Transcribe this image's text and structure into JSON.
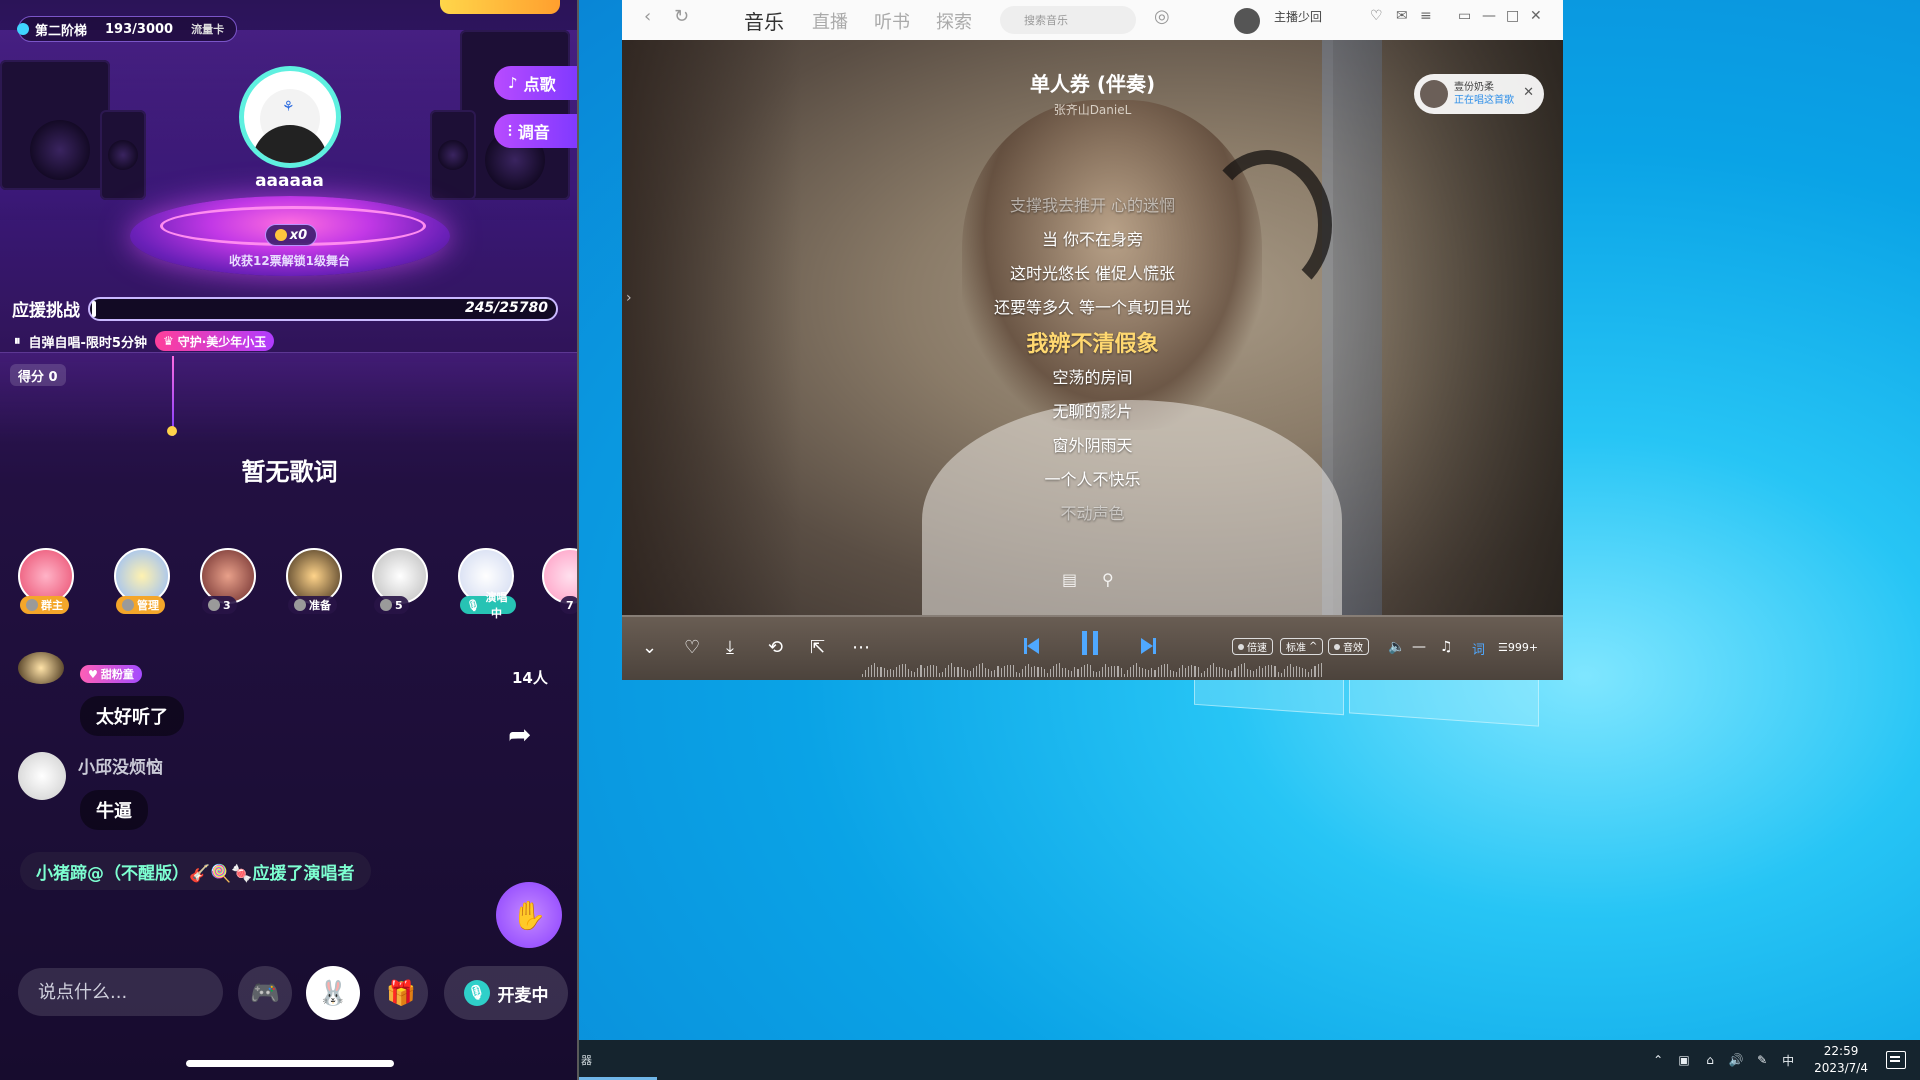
{
  "live_room": {
    "tier_label": "第二阶梯",
    "tier_progress": "193/3000",
    "traffic_card": "流量卡",
    "request_song": "点歌",
    "tune": "调音",
    "host_name": "aaaaaa",
    "podium_count": "x0",
    "podium_note": "收获12票解锁1级舞台",
    "support_label": "应援挑战",
    "support_value": "245/25780",
    "support_current": 245,
    "support_total": 25780,
    "mode_text": "自弹自唱-限时5分钟",
    "guard_chip": "守护·美少年小玉",
    "score": "得分 0",
    "no_lyrics": "暂无歌词",
    "seats": [
      {
        "tag": "群主"
      },
      {
        "tag": "管理"
      },
      {
        "tag": "3"
      },
      {
        "tag": "准备"
      },
      {
        "tag": "5"
      },
      {
        "tag": "演唱中"
      },
      {
        "tag": "7"
      }
    ],
    "people_count": "14人",
    "fan_badge": "甜粉童",
    "chat": [
      {
        "user": "",
        "text": "太好听了"
      },
      {
        "user": "小邱没烦恼",
        "text": "牛逼"
      }
    ],
    "system_msg": "小猪蹄@（不醒版）🎸🍭🍬应援了演唱者",
    "say_placeholder": "说点什么...",
    "mic_label": "开麦中"
  },
  "player": {
    "nav_tabs": [
      "音乐",
      "直播",
      "听书",
      "探索"
    ],
    "search_placeholder": "搜索音乐",
    "user_name": "主播少回",
    "song_title": "单人券 (伴奏)",
    "artist": "张齐山DanieL",
    "listener_name": "壹份奶柔",
    "listener_status": "正在唱这首歌",
    "lyrics": [
      {
        "text": "支撑我去推开 心的迷惘",
        "state": "dim"
      },
      {
        "text": "当 你不在身旁",
        "state": "normal"
      },
      {
        "text": "这时光悠长 催促人慌张",
        "state": "normal"
      },
      {
        "text": "还要等多久 等一个真切目光",
        "state": "normal"
      },
      {
        "text": "我辨不清假象",
        "state": "active"
      },
      {
        "text": "空荡的房间",
        "state": "normal"
      },
      {
        "text": "无聊的影片",
        "state": "normal"
      },
      {
        "text": "窗外阴雨天",
        "state": "normal"
      },
      {
        "text": "一个人不快乐",
        "state": "normal"
      },
      {
        "text": "不动声色",
        "state": "dim"
      }
    ],
    "chip_speed": "倍速",
    "chip_quality": "标准",
    "chip_effect": "音效",
    "lyric_btn": "词",
    "queue_count": "999+",
    "progress": 0
  },
  "taskbar": {
    "left_glyph": "器",
    "ime": "中",
    "time": "22:59",
    "date": "2023/7/4"
  }
}
